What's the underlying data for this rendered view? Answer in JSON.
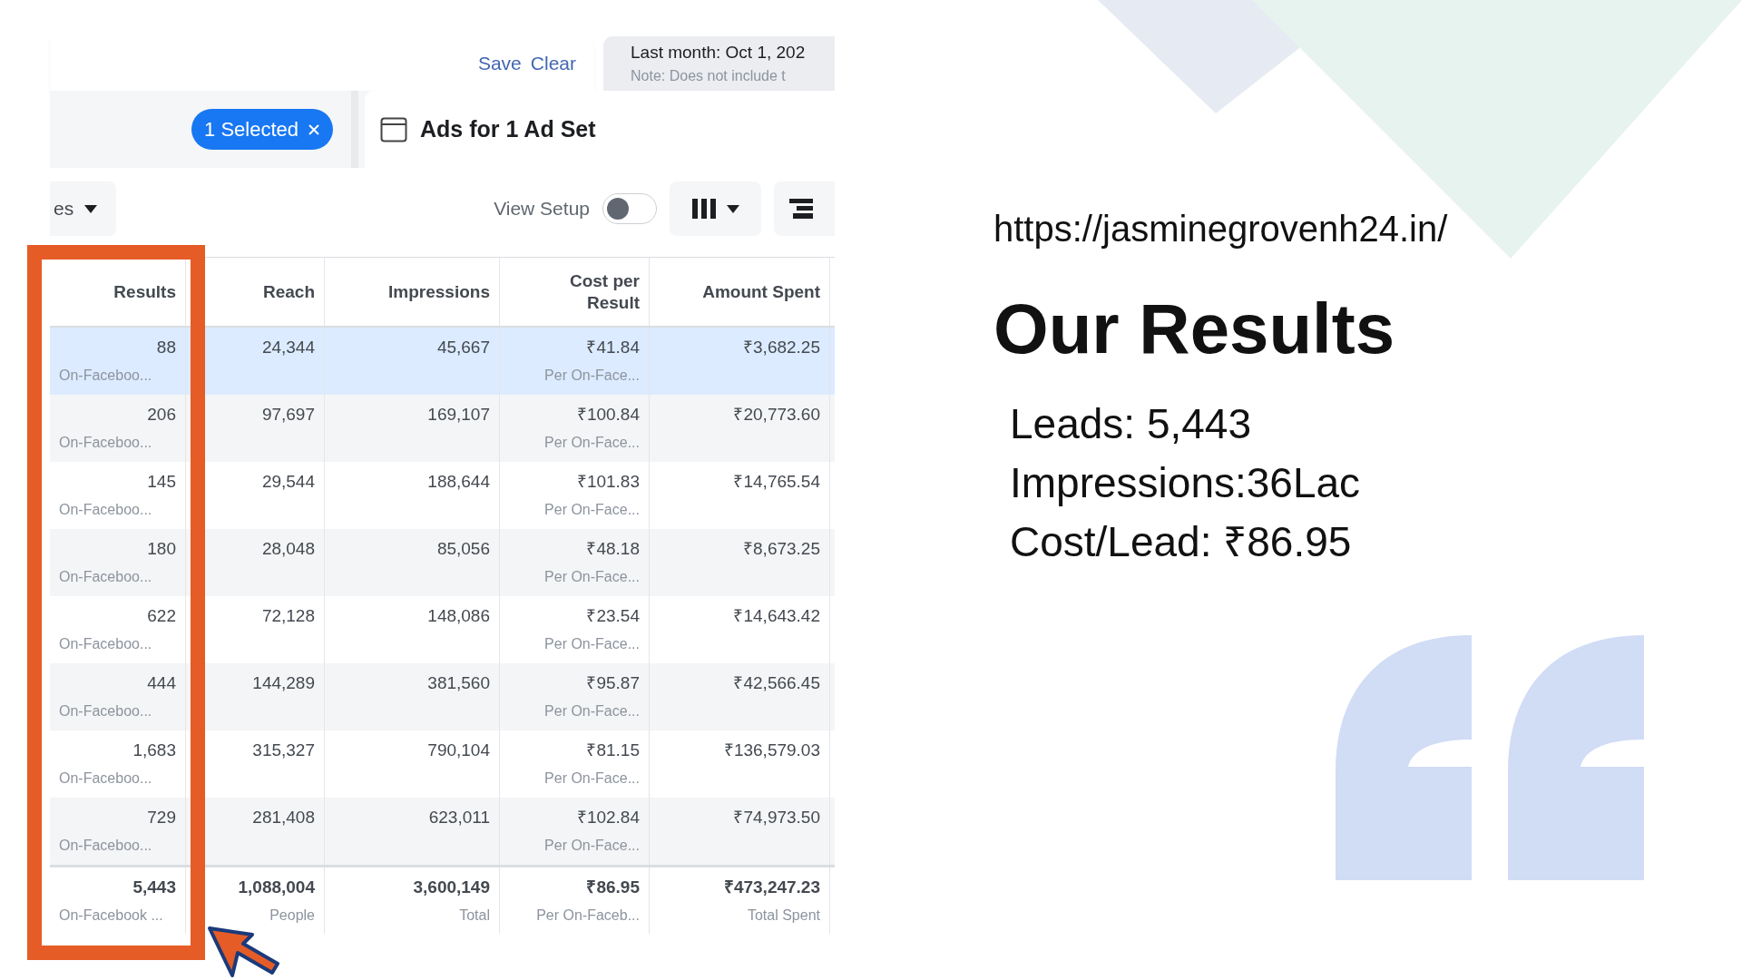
{
  "toolbar": {
    "links": [
      "Save",
      "Clear"
    ],
    "date_range": "Last month: Oct 1, 202",
    "date_note": "Note: Does not include t"
  },
  "selection": {
    "pill": "1 Selected",
    "tab": "Ads for 1 Ad Set"
  },
  "controls": {
    "dropdown": "es",
    "view_setup": "View Setup",
    "view_setup_on": false
  },
  "table": {
    "columns": [
      "Results",
      "Reach",
      "Impressions",
      "Cost per Result",
      "Amount Spent"
    ],
    "rows": [
      {
        "selected": true,
        "results": "88",
        "results_label": "On-Faceboo...",
        "reach": "24,344",
        "impressions": "45,667",
        "cost": "₹41.84",
        "cost_label": "Per On-Face...",
        "amount": "₹3,682.25"
      },
      {
        "selected": false,
        "results": "206",
        "results_label": "On-Faceboo...",
        "reach": "97,697",
        "impressions": "169,107",
        "cost": "₹100.84",
        "cost_label": "Per On-Face...",
        "amount": "₹20,773.60"
      },
      {
        "selected": false,
        "results": "145",
        "results_label": "On-Faceboo...",
        "reach": "29,544",
        "impressions": "188,644",
        "cost": "₹101.83",
        "cost_label": "Per On-Face...",
        "amount": "₹14,765.54"
      },
      {
        "selected": false,
        "results": "180",
        "results_label": "On-Faceboo...",
        "reach": "28,048",
        "impressions": "85,056",
        "cost": "₹48.18",
        "cost_label": "Per On-Face...",
        "amount": "₹8,673.25"
      },
      {
        "selected": false,
        "results": "622",
        "results_label": "On-Faceboo...",
        "reach": "72,128",
        "impressions": "148,086",
        "cost": "₹23.54",
        "cost_label": "Per On-Face...",
        "amount": "₹14,643.42"
      },
      {
        "selected": false,
        "results": "444",
        "results_label": "On-Faceboo...",
        "reach": "144,289",
        "impressions": "381,560",
        "cost": "₹95.87",
        "cost_label": "Per On-Face...",
        "amount": "₹42,566.45"
      },
      {
        "selected": false,
        "results": "1,683",
        "results_label": "On-Faceboo...",
        "reach": "315,327",
        "impressions": "790,104",
        "cost": "₹81.15",
        "cost_label": "Per On-Face...",
        "amount": "₹136,579.03"
      },
      {
        "selected": false,
        "results": "729",
        "results_label": "On-Faceboo...",
        "reach": "281,408",
        "impressions": "623,011",
        "cost": "₹102.84",
        "cost_label": "Per On-Face...",
        "amount": "₹74,973.50"
      }
    ],
    "total": {
      "results": "5,443",
      "results_label": "On-Facebook ...",
      "reach": "1,088,004",
      "reach_label": "People",
      "impressions": "3,600,149",
      "impressions_label": "Total",
      "cost": "₹86.95",
      "cost_label": "Per On-Faceb...",
      "amount": "₹473,247.23",
      "amount_label": "Total Spent"
    }
  },
  "slide": {
    "url": "https://jasminegrovenh24.in/",
    "title": "Our Results",
    "stats": [
      "Leads: 5,443",
      "Impressions:36Lac",
      "Cost/Lead: ₹86.95"
    ]
  }
}
